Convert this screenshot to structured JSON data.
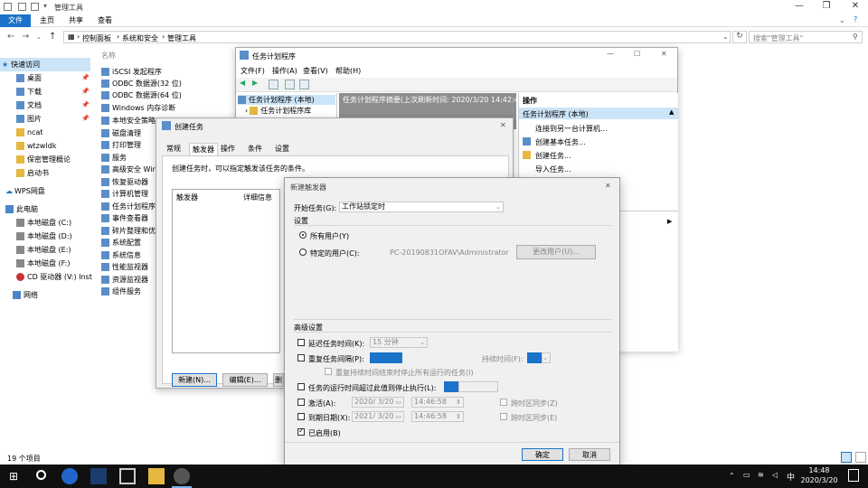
{
  "explorer": {
    "title": "管理工具",
    "ribbon_tabs": [
      "文件",
      "主页",
      "共享",
      "查看"
    ],
    "breadcrumb": [
      "控制面板",
      "系统和安全",
      "管理工具"
    ],
    "search_placeholder": "搜索\"管理工具\"",
    "column_header": "名称",
    "nav_items": [
      {
        "label": "快速访问",
        "pinned": false
      },
      {
        "label": "桌面",
        "pinned": true
      },
      {
        "label": "下载",
        "pinned": true
      },
      {
        "label": "文档",
        "pinned": true
      },
      {
        "label": "图片",
        "pinned": true
      },
      {
        "label": "ncat",
        "pinned": false
      },
      {
        "label": "wtzwldk",
        "pinned": false
      },
      {
        "label": "保密管理概论",
        "pinned": false
      },
      {
        "label": "启动书",
        "pinned": false
      },
      {
        "label": "WPS网盘",
        "pinned": false
      },
      {
        "label": "此电脑",
        "pinned": false
      },
      {
        "label": "本地磁盘 (C:)",
        "pinned": false
      },
      {
        "label": "本地磁盘 (D:)",
        "pinned": false
      },
      {
        "label": "本地磁盘 (E:)",
        "pinned": false
      },
      {
        "label": "本地磁盘 (F:)",
        "pinned": false
      },
      {
        "label": "CD 驱动器 (V:) Inst",
        "pinned": false
      },
      {
        "label": "网络",
        "pinned": false
      }
    ],
    "files": [
      "iSCSI 发起程序",
      "ODBC 数据源(32 位)",
      "ODBC 数据源(64 位)",
      "Windows 内存诊断",
      "本地安全策略",
      "磁盘清理",
      "打印管理",
      "服务",
      "高级安全 Wind",
      "恢复驱动器",
      "计算机管理",
      "任务计划程序",
      "事件查看器",
      "碎片整理和优化",
      "系统配置",
      "系统信息",
      "性能监视器",
      "资源监视器",
      "组件服务"
    ],
    "status": "19 个项目"
  },
  "task_scheduler": {
    "title": "任务计划程序",
    "menu": [
      "文件(F)",
      "操作(A)",
      "查看(V)",
      "帮助(H)"
    ],
    "tree": [
      "任务计划程序 (本地)",
      "任务计划程序库"
    ],
    "summary_header": "任务计划程序摘要(上次刷新时间: 2020/3/20 14:42:45)",
    "actions_header": "操作",
    "actions_section": "任务计划程序 (本地)",
    "actions": [
      "连接到另一台计算机...",
      "创建基本任务...",
      "创建任务...",
      "导入任务..."
    ]
  },
  "create_task": {
    "title": "创建任务",
    "tabs": [
      "常规",
      "触发器",
      "操作",
      "条件",
      "设置"
    ],
    "desc": "创建任务时，可以指定触发该任务的条件。",
    "col_trigger": "触发器",
    "col_detail": "详细信息",
    "btn_new": "新建(N)...",
    "btn_edit": "编辑(E)...",
    "btn_delete": "删"
  },
  "new_trigger": {
    "title": "新建触发器",
    "start_label": "开始任务(G):",
    "start_value": "工作站锁定时",
    "settings_label": "设置",
    "any_user": "所有用户(Y)",
    "specific_user": "特定的用户(C):",
    "user_value": "PC-20190831OFAV\\Administrator",
    "change_user": "更改用户(U)...",
    "advanced_label": "高级设置",
    "delay_label": "延迟任务时间(K):",
    "delay_value": "15 分钟",
    "repeat_label": "重复任务间隔(P):",
    "duration_label": "持续时间(F):",
    "stop_all_label": "重复持续时间结束时停止所有运行的任务(I)",
    "stop_if_label": "任务的运行时间超过此值则停止执行(L):",
    "activate_label": "激活(A):",
    "activate_date": "2020/ 3/20",
    "activate_time": "14:46:58",
    "sync_label": "跨时区同步(Z)",
    "expire_label": "到期日期(X):",
    "expire_date": "2021/ 3/20",
    "expire_time": "14:46:58",
    "sync_label2": "跨时区同步(E)",
    "enabled_label": "已启用(B)",
    "ok": "确定",
    "cancel": "取消"
  },
  "taskbar": {
    "time": "14:48",
    "date": "2020/3/20",
    "ime": "中"
  }
}
